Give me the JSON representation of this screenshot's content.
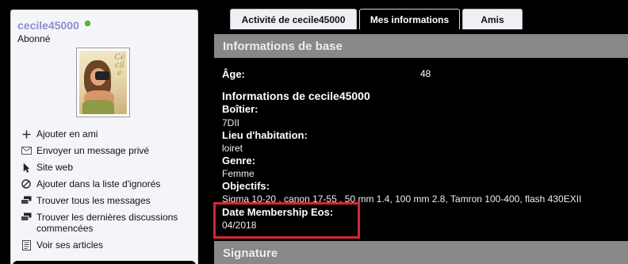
{
  "profile": {
    "username": "cecile45000",
    "status_color": "#5fbf3a",
    "user_title": "Abonné",
    "avatar_signature": "Cécile",
    "actions": [
      {
        "icon": "plus-icon",
        "label": "Ajouter en ami"
      },
      {
        "icon": "envelope-icon",
        "label": "Envoyer un message privé"
      },
      {
        "icon": "cursor-icon",
        "label": "Site web"
      },
      {
        "icon": "block-icon",
        "label": "Ajouter dans la liste d'ignorés"
      },
      {
        "icon": "messages-icon",
        "label": "Trouver tous les messages"
      },
      {
        "icon": "discussions-icon",
        "label": "Trouver les dernières discussions commencées"
      },
      {
        "icon": "articles-icon",
        "label": "Voir ses articles"
      }
    ]
  },
  "tabs": [
    {
      "label": "Activité de cecile45000",
      "active": false
    },
    {
      "label": "Mes informations",
      "active": true
    },
    {
      "label": "Amis",
      "active": false
    }
  ],
  "basic_info": {
    "header": "Informations de base",
    "age_label": "Âge:",
    "age_value": "48"
  },
  "user_info": {
    "title": "Informations de cecile45000",
    "fields": [
      {
        "label": "Boîtier:",
        "value": "7DII"
      },
      {
        "label": "Lieu d'habitation:",
        "value": "loiret"
      },
      {
        "label": "Genre:",
        "value": "Femme"
      },
      {
        "label": "Objectifs:",
        "value": "Sigma 10-20 , canon 17-55 , 50 mm 1.4, 100 mm 2.8, Tamron 100-400, flash 430EXII"
      },
      {
        "label": "Date Membership Eos:",
        "value": "04/2018"
      }
    ]
  },
  "signature": {
    "header": "Signature"
  },
  "colors": {
    "highlight": "#d1282e",
    "section_header_bg": "#888888",
    "username": "#8c8fd0"
  }
}
